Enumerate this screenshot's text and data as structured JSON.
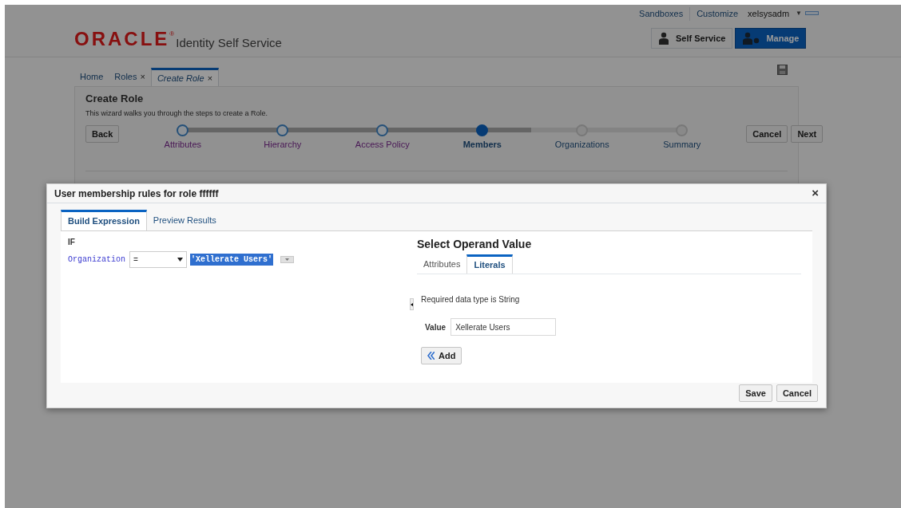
{
  "top_links": [
    {
      "label": "Sandboxes"
    },
    {
      "label": "Customize"
    }
  ],
  "user_menu": {
    "label": "xelsysadm",
    "caret": "▼"
  },
  "header": {
    "logo": "ORACLE",
    "logo_mark": "®",
    "product": "Identity Self Service"
  },
  "header_buttons": [
    {
      "label": "Self Service",
      "selected": false
    },
    {
      "label": "Manage",
      "selected": true
    }
  ],
  "tabs": [
    {
      "label": "Home",
      "selected": false
    },
    {
      "label": "Roles",
      "close": "×",
      "selected": false
    },
    {
      "label": "Create Role",
      "close": "×",
      "selected": true
    }
  ],
  "wizard": {
    "title": "Create Role",
    "description": "This wizard walks you through the steps to create a Role.",
    "back": "Back",
    "cancel": "Cancel",
    "next": "Next",
    "steps": [
      {
        "label": "Attributes",
        "visited": true,
        "selected": false
      },
      {
        "label": "Hierarchy",
        "visited": true,
        "selected": false
      },
      {
        "label": "Access Policy",
        "visited": true,
        "selected": false
      },
      {
        "label": "Members",
        "visited": false,
        "selected": true
      },
      {
        "label": "Organizations",
        "visited": false,
        "selected": false
      },
      {
        "label": "Summary",
        "visited": false,
        "selected": false
      }
    ]
  },
  "dialog": {
    "title": "User membership rules for role ffffff",
    "close": "×",
    "tabs": [
      {
        "label": "Build Expression",
        "selected": true
      },
      {
        "label": "Preview Results",
        "selected": false
      }
    ],
    "if_label": "IF",
    "condition": {
      "attribute": "Organization",
      "operator": "=",
      "value": "'Xellerate Users'"
    },
    "operand_panel": {
      "title": "Select Operand Value",
      "tabs": [
        {
          "label": "Attributes",
          "selected": false
        },
        {
          "label": "Literals",
          "selected": true
        }
      ],
      "hint": "Required data type is String",
      "value_label": "Value",
      "value": "Xellerate Users",
      "add": "Add"
    },
    "buttons": [
      "Save",
      "Cancel"
    ]
  }
}
